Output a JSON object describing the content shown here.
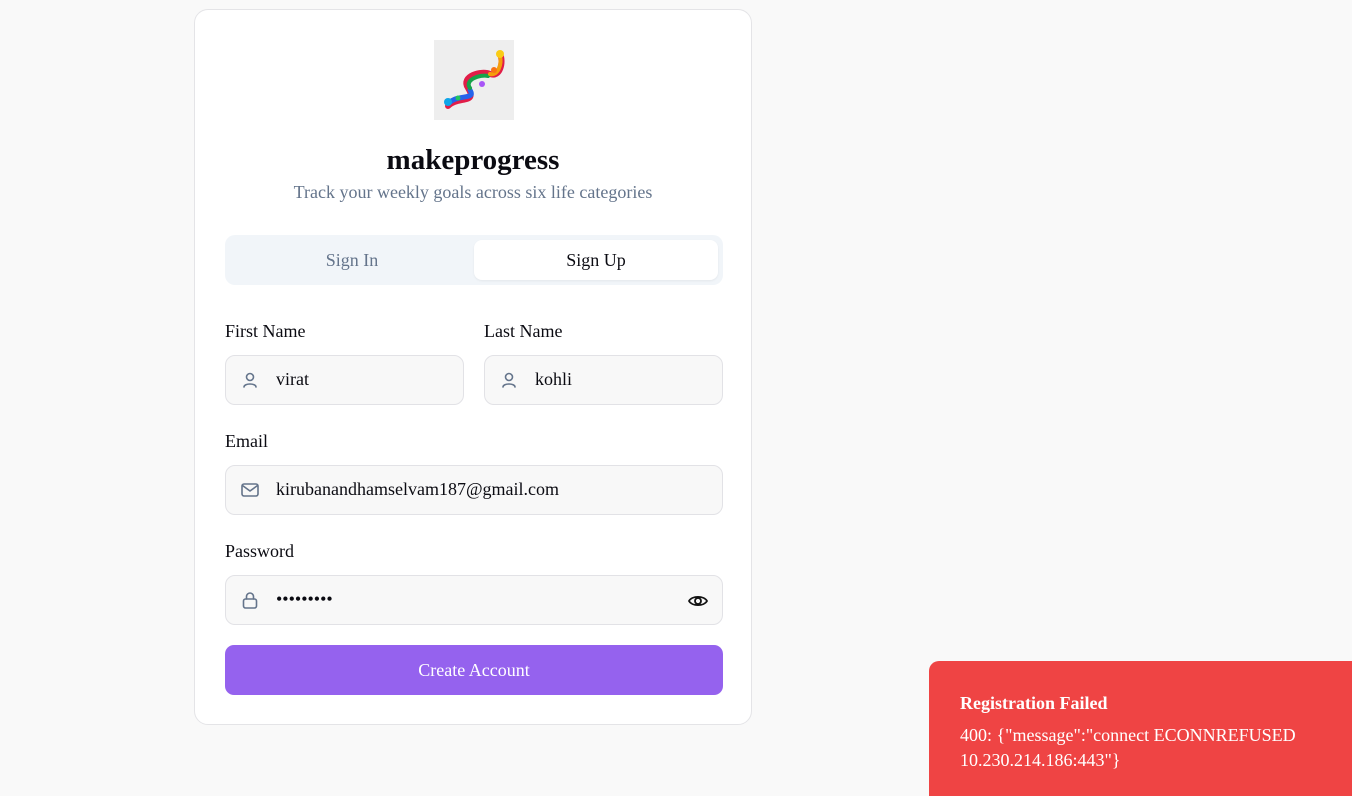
{
  "app": {
    "title": "makeprogress",
    "subtitle": "Track your weekly goals across six life categories"
  },
  "tabs": [
    {
      "label": "Sign In",
      "active": false
    },
    {
      "label": "Sign Up",
      "active": true
    }
  ],
  "form": {
    "first_name": {
      "label": "First Name",
      "value": "virat",
      "icon": "user-icon"
    },
    "last_name": {
      "label": "Last Name",
      "value": "kohli",
      "icon": "user-icon"
    },
    "email": {
      "label": "Email",
      "value": "kirubanandhamselvam187@gmail.com",
      "icon": "mail-icon"
    },
    "password": {
      "label": "Password",
      "value": "•••••••••",
      "icon": "lock-icon",
      "toggle_icon": "eye-icon"
    },
    "submit_label": "Create Account"
  },
  "toast": {
    "title": "Registration Failed",
    "message": "400: {\"message\":\"connect ECONNREFUSED 10.230.214.186:443\"}"
  },
  "colors": {
    "accent": "#9562ee",
    "error": "#ef4444",
    "muted_text": "#64748b",
    "background": "#f9f9f9"
  }
}
